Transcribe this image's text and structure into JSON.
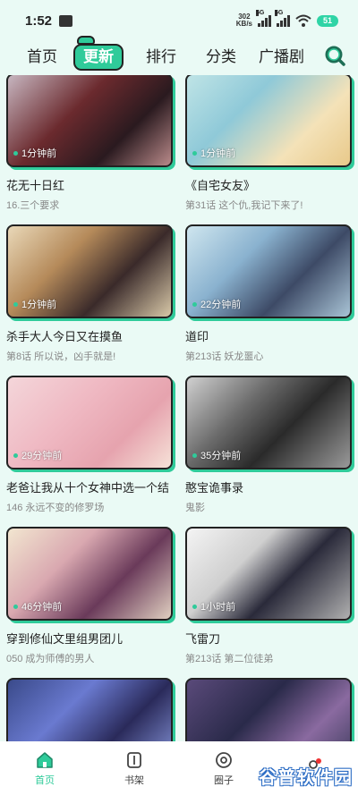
{
  "status_bar": {
    "time": "1:52",
    "net_speed_value": "302",
    "net_speed_unit": "KB/s",
    "signal1_label": "5G",
    "signal2_label": "5G",
    "battery": "51"
  },
  "nav": {
    "tabs": [
      "首页",
      "更新",
      "排行",
      "分类",
      "广播剧"
    ],
    "active_tab": "更新"
  },
  "comics": [
    {
      "title": "花无十日红",
      "subtitle": "16.三个要求",
      "time": "1分钟前"
    },
    {
      "title": "《自宅女友》",
      "subtitle": "第31话 这个仇,我记下来了!",
      "time": "1分钟前"
    },
    {
      "title": "杀手大人今日又在摸鱼",
      "subtitle": "第8话 所以说，凶手就是!",
      "time": "1分钟前"
    },
    {
      "title": "道印",
      "subtitle": "第213话 妖龙噩心",
      "time": "22分钟前"
    },
    {
      "title": "老爸让我从十个女神中选一个结",
      "subtitle": "146 永远不变的修罗场",
      "time": "29分钟前"
    },
    {
      "title": "憨宝诡事录",
      "subtitle": "鬼影",
      "time": "35分钟前"
    },
    {
      "title": "穿到修仙文里组男团儿",
      "subtitle": "050 成为师傅的男人",
      "time": "46分钟前"
    },
    {
      "title": "飞雷刀",
      "subtitle": "第213话 第二位徒弟",
      "time": "1小时前"
    },
    {
      "title": "",
      "subtitle": "",
      "time": ""
    },
    {
      "title": "",
      "subtitle": "",
      "time": ""
    }
  ],
  "bottom_nav": {
    "items": [
      "首页",
      "书架",
      "圈子",
      ""
    ],
    "active": "首页"
  },
  "watermark": "谷普软件园",
  "colors": {
    "accent": "#2fcb9a",
    "background": "#eafaf5"
  }
}
